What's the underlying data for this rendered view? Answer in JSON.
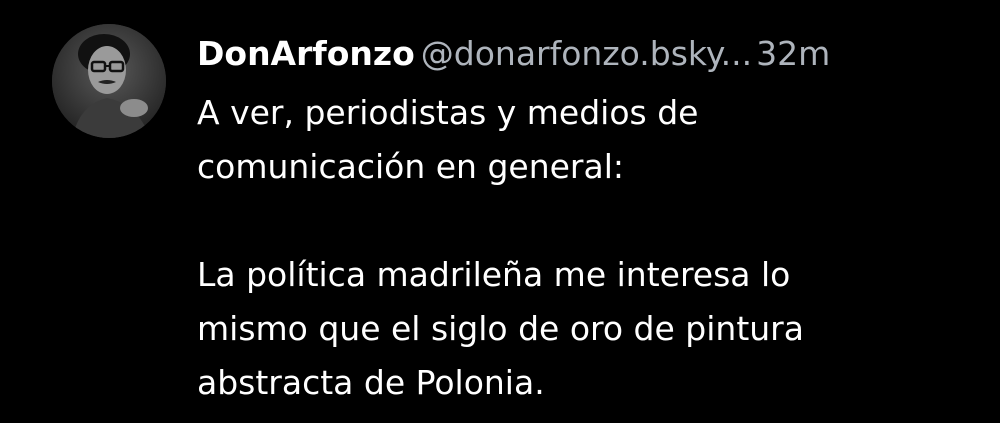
{
  "post": {
    "author": {
      "display_name": "DonArfonzo",
      "handle": "@donarfonzo.bsky...",
      "avatar_icon": "user-avatar-photo"
    },
    "timestamp": "32m",
    "text_lines": [
      "A ver, periodistas y medios de",
      "comunicación en general:",
      "",
      "La política madrileña me interesa lo",
      "mismo que el siglo de oro de pintura",
      "abstracta de Polonia."
    ]
  },
  "colors": {
    "background": "#000000",
    "text": "#ffffff",
    "muted": "#aeb4bc"
  }
}
